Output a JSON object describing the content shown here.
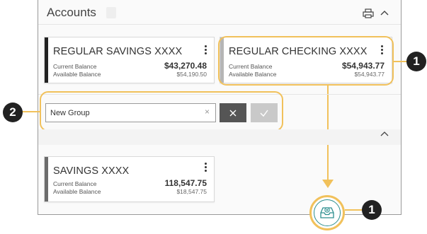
{
  "header": {
    "title": "Accounts",
    "edit_icon": "pencil-icon",
    "print_icon": "printer-icon",
    "collapse_icon": "chevron-up-icon"
  },
  "cards": [
    {
      "name": "REGULAR SAVINGS XXXX",
      "current_label": "Current Balance",
      "current_value": "$43,270.48",
      "available_label": "Available Balance",
      "available_value": "$54,190.50",
      "bar_color": "#222222"
    },
    {
      "name": "REGULAR CHECKING XXXX",
      "current_label": "Current Balance",
      "current_value": "$54,943.77",
      "available_label": "Available Balance",
      "available_value": "$54,943.77",
      "bar_color": "#b5b5b5"
    },
    {
      "name": "SAVINGS XXXX",
      "current_label": "Current Balance",
      "current_value": "118,547.75",
      "available_label": "Available Balance",
      "available_value": "$18,547.75",
      "bar_color": "#6b6b6b"
    }
  ],
  "new_group": {
    "value": "New Group",
    "clear_icon": "close-icon",
    "cancel_icon": "close-icon",
    "confirm_icon": "checkmark-icon"
  },
  "callouts": {
    "badge_1": "1",
    "badge_2": "2",
    "badge_3": "1"
  },
  "accent_color": "#f1c15b",
  "drop_icon": "inbox-add-icon"
}
